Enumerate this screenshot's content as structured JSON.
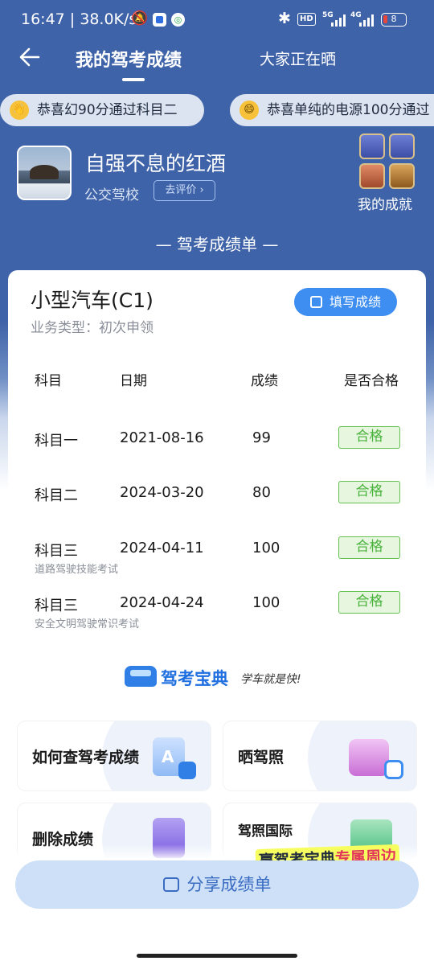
{
  "status_bar": {
    "time_speed": "16:47 | 38.0K/s",
    "hd_label": "HD",
    "net1_label": "5G",
    "net2_label": "4G",
    "battery": "8"
  },
  "header": {
    "title": "我的驾考成绩",
    "tab_other": "大家正在晒"
  },
  "ticker": [
    {
      "emoji": "👋",
      "text": "恭喜幻90分通过科目二"
    },
    {
      "emoji": "😄",
      "text": "恭喜单纯的电源100分通过"
    }
  ],
  "profile": {
    "username": "自强不息的红酒",
    "school": "公交驾校",
    "review_label": "去评价 ›",
    "achievements_label": "我的成就"
  },
  "section_title": "— 驾考成绩单 —",
  "score_card": {
    "vehicle": "小型汽车(C1)",
    "business_type": "业务类型：初次申领",
    "fill_button": "填写成绩",
    "headers": [
      "科目",
      "日期",
      "成绩",
      "是否合格"
    ],
    "rows": [
      {
        "subject": "科目一",
        "date": "2021-08-16",
        "score": "99",
        "status": "合格",
        "note": ""
      },
      {
        "subject": "科目二",
        "date": "2024-03-20",
        "score": "80",
        "status": "合格",
        "note": ""
      },
      {
        "subject": "科目三",
        "date": "2024-04-11",
        "score": "100",
        "status": "合格",
        "note": "道路驾驶技能考试"
      },
      {
        "subject": "科目三",
        "date": "2024-04-24",
        "score": "100",
        "status": "合格",
        "note": "安全文明驾驶常识考试"
      }
    ],
    "brand_name": "驾考宝典",
    "brand_slogan": "学车就是快!"
  },
  "tiles": {
    "check_scores": "如何查驾考成绩",
    "show_license": "晒驾照",
    "delete_scores": "删除成绩",
    "intl_license": "驾照国际"
  },
  "promo": {
    "prefix": "赢驾考宝典",
    "highlight": "专属周边"
  },
  "share_button": "分享成绩单"
}
